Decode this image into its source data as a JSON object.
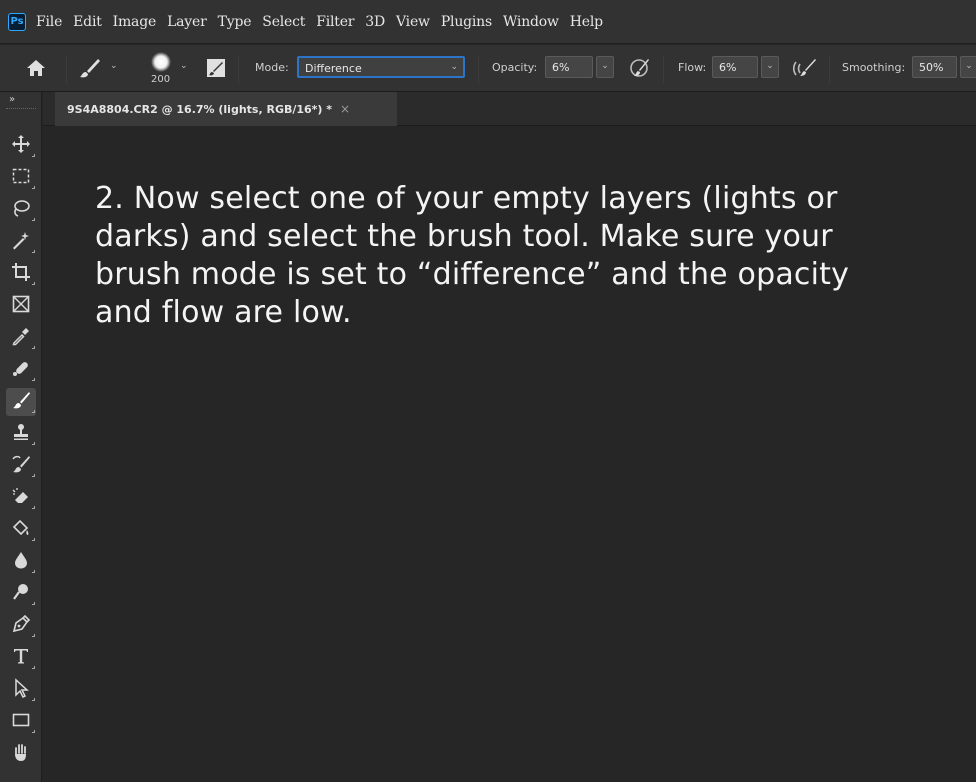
{
  "menubar": {
    "logo": "Ps",
    "items": [
      "File",
      "Edit",
      "Image",
      "Layer",
      "Type",
      "Select",
      "Filter",
      "3D",
      "View",
      "Plugins",
      "Window",
      "Help"
    ]
  },
  "options": {
    "brush_size": "200",
    "mode_label": "Mode:",
    "mode_value": "Difference",
    "opacity_label": "Opacity:",
    "opacity_value": "6%",
    "flow_label": "Flow:",
    "flow_value": "6%",
    "smoothing_label": "Smoothing:",
    "smoothing_value": "50%"
  },
  "toolbar": {
    "collapse": "»",
    "active_tool": "brush-tool"
  },
  "document": {
    "tab_title": "9S4A8804.CR2 @ 16.7% (lights, RGB/16*) *",
    "close_glyph": "×"
  },
  "canvas": {
    "instruction": "2. Now select one of your empty layers  (lights or darks) and select the brush tool.  Make sure your brush mode is set to “difference” and the opacity and flow are low."
  },
  "colors": {
    "panel": "#323232",
    "canvas": "#262626",
    "accent": "#2d74c9",
    "ps_logo": "#31a8ff"
  }
}
